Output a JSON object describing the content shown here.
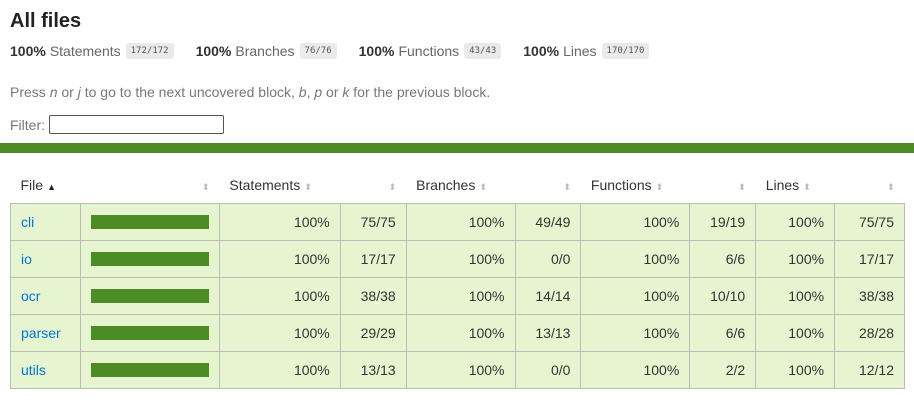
{
  "title": "All files",
  "summary": [
    {
      "pct": "100%",
      "label": "Statements",
      "fraction": "172/172"
    },
    {
      "pct": "100%",
      "label": "Branches",
      "fraction": "76/76"
    },
    {
      "pct": "100%",
      "label": "Functions",
      "fraction": "43/43"
    },
    {
      "pct": "100%",
      "label": "Lines",
      "fraction": "170/170"
    }
  ],
  "hint": {
    "t1": "Press ",
    "k1": "n",
    "t2": " or ",
    "k2": "j",
    "t3": " to go to the next uncovered block, ",
    "k3": "b",
    "t4": ", ",
    "k4": "p",
    "t5": " or ",
    "k5": "k",
    "t6": " for the previous block."
  },
  "filter": {
    "label": "Filter:",
    "value": ""
  },
  "headers": {
    "file": "File",
    "statements": "Statements",
    "branches": "Branches",
    "functions": "Functions",
    "lines": "Lines",
    "sort_up": "▲",
    "sort_both": "⬍"
  },
  "rows": [
    {
      "file": "cli",
      "coverage": 1.0,
      "stmt_pct": "100%",
      "stmt": "75/75",
      "br_pct": "100%",
      "br": "49/49",
      "fn_pct": "100%",
      "fn": "19/19",
      "ln_pct": "100%",
      "ln": "75/75"
    },
    {
      "file": "io",
      "coverage": 1.0,
      "stmt_pct": "100%",
      "stmt": "17/17",
      "br_pct": "100%",
      "br": "0/0",
      "fn_pct": "100%",
      "fn": "6/6",
      "ln_pct": "100%",
      "ln": "17/17"
    },
    {
      "file": "ocr",
      "coverage": 1.0,
      "stmt_pct": "100%",
      "stmt": "38/38",
      "br_pct": "100%",
      "br": "14/14",
      "fn_pct": "100%",
      "fn": "10/10",
      "ln_pct": "100%",
      "ln": "38/38"
    },
    {
      "file": "parser",
      "coverage": 1.0,
      "stmt_pct": "100%",
      "stmt": "29/29",
      "br_pct": "100%",
      "br": "13/13",
      "fn_pct": "100%",
      "fn": "6/6",
      "ln_pct": "100%",
      "ln": "28/28"
    },
    {
      "file": "utils",
      "coverage": 1.0,
      "stmt_pct": "100%",
      "stmt": "13/13",
      "br_pct": "100%",
      "br": "0/0",
      "fn_pct": "100%",
      "fn": "2/2",
      "ln_pct": "100%",
      "ln": "12/12"
    }
  ],
  "colors": {
    "high": "#4d8c24",
    "row_bg": "#e6f5d0",
    "link": "#0074d9"
  }
}
